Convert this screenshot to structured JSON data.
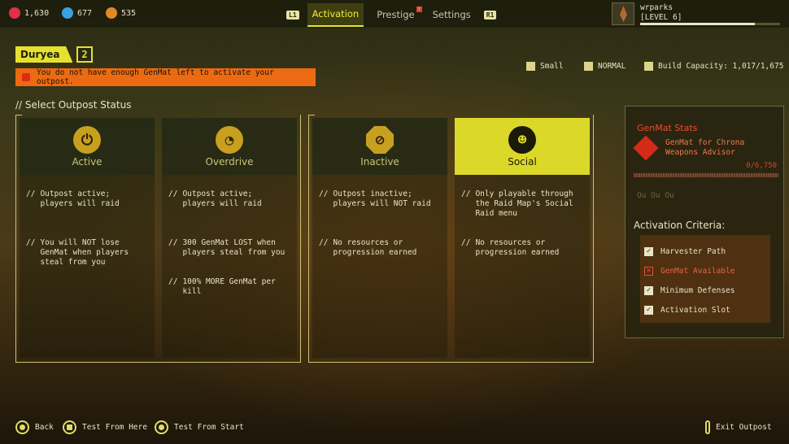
{
  "resources": [
    {
      "icon": "gear-resource-icon",
      "value": "1,630",
      "color": "#e0304a"
    },
    {
      "icon": "shield-resource-icon",
      "value": "677",
      "color": "#3aa0e0"
    },
    {
      "icon": "chip-resource-icon",
      "value": "535",
      "color": "#e08a20"
    }
  ],
  "tabs": {
    "left_hint": "L1",
    "items": [
      {
        "label": "Activation",
        "active": true
      },
      {
        "label": "Prestige",
        "alert": "!"
      },
      {
        "label": "Settings"
      }
    ],
    "right_hint": "R1"
  },
  "user": {
    "name": "wrparks",
    "level": "[LEVEL 6]",
    "xp_fraction": 0.82
  },
  "outpost": {
    "name": "Duryea",
    "level": "2",
    "warning": "You do not have enough GenMat left to activate your outpost.",
    "size": "Small",
    "difficulty": "NORMAL",
    "build_capacity": "Build Capacity: 1,017/1,675"
  },
  "section_title": "// Select Outpost Status",
  "status_cards": [
    {
      "label": "Active",
      "icon": "power-icon",
      "notes": [
        "Outpost active; players will raid",
        "You will NOT lose GenMat when players steal from you"
      ]
    },
    {
      "label": "Overdrive",
      "icon": "gauge-icon",
      "notes": [
        "Outpost active; players will raid",
        "300 GenMat LOST when players steal from you",
        "100% MORE GenMat per kill"
      ]
    },
    {
      "label": "Inactive",
      "icon": "power-off-icon",
      "notes": [
        "Outpost inactive; players will NOT raid",
        "No resources or progression earned"
      ]
    },
    {
      "label": "Social",
      "icon": "people-icon",
      "selected": true,
      "notes": [
        "Only playable through the Raid Map's Social Raid menu",
        "No resources or progression earned"
      ]
    }
  ],
  "note_prefix": "//",
  "genmat_stats": {
    "title": "GenMat Stats",
    "description": "GenMat for Chrona Weapons Advisor",
    "count": "0/6,750",
    "ghost": "Ou Ou Ou"
  },
  "activation_criteria": {
    "title": "Activation Criteria:",
    "items": [
      {
        "label": "Harvester Path",
        "met": true
      },
      {
        "label": "GenMat Available",
        "met": false
      },
      {
        "label": "Minimum Defenses",
        "met": true
      },
      {
        "label": "Activation Slot",
        "met": true
      }
    ]
  },
  "footer": {
    "back": "Back",
    "test_here": "Test From Here",
    "test_start": "Test From Start",
    "exit": "Exit Outpost"
  },
  "colors": {
    "accent": "#e6e030",
    "warning": "#ec6a12",
    "error": "#ee4a30"
  }
}
